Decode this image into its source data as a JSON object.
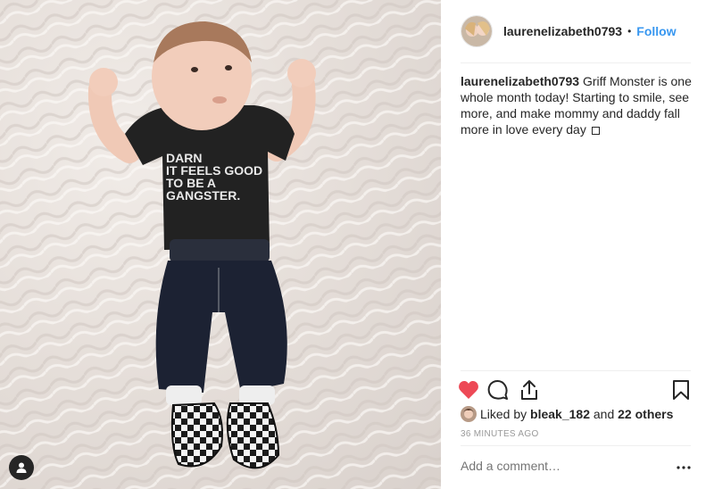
{
  "post": {
    "username": "laurenelizabeth0793",
    "separator": "•",
    "follow_label": "Follow",
    "caption_text": " Griff Monster is one whole month today! Starting to smile, see more, and make mommy and daddy fall more in love every day",
    "liked_by_prefix": "Liked by",
    "liked_by_user": "bleak_182",
    "liked_by_conj": "and",
    "liked_by_others": "22 others",
    "timestamp": "36 minutes ago",
    "comment_placeholder": "Add a comment…",
    "like_state": "liked"
  },
  "shirt_text": [
    "DARN",
    "IT FEELS GOOD",
    "TO BE A",
    "GANGSTER."
  ],
  "icons": {
    "like": "heart-icon",
    "comment": "comment-icon",
    "share": "share-icon",
    "save": "bookmark-icon",
    "more": "ellipsis-icon",
    "tag": "user-tag-icon"
  },
  "colors": {
    "accent": "#3897f0",
    "liked": "#ed4956",
    "text": "#262626",
    "muted": "#999999"
  }
}
